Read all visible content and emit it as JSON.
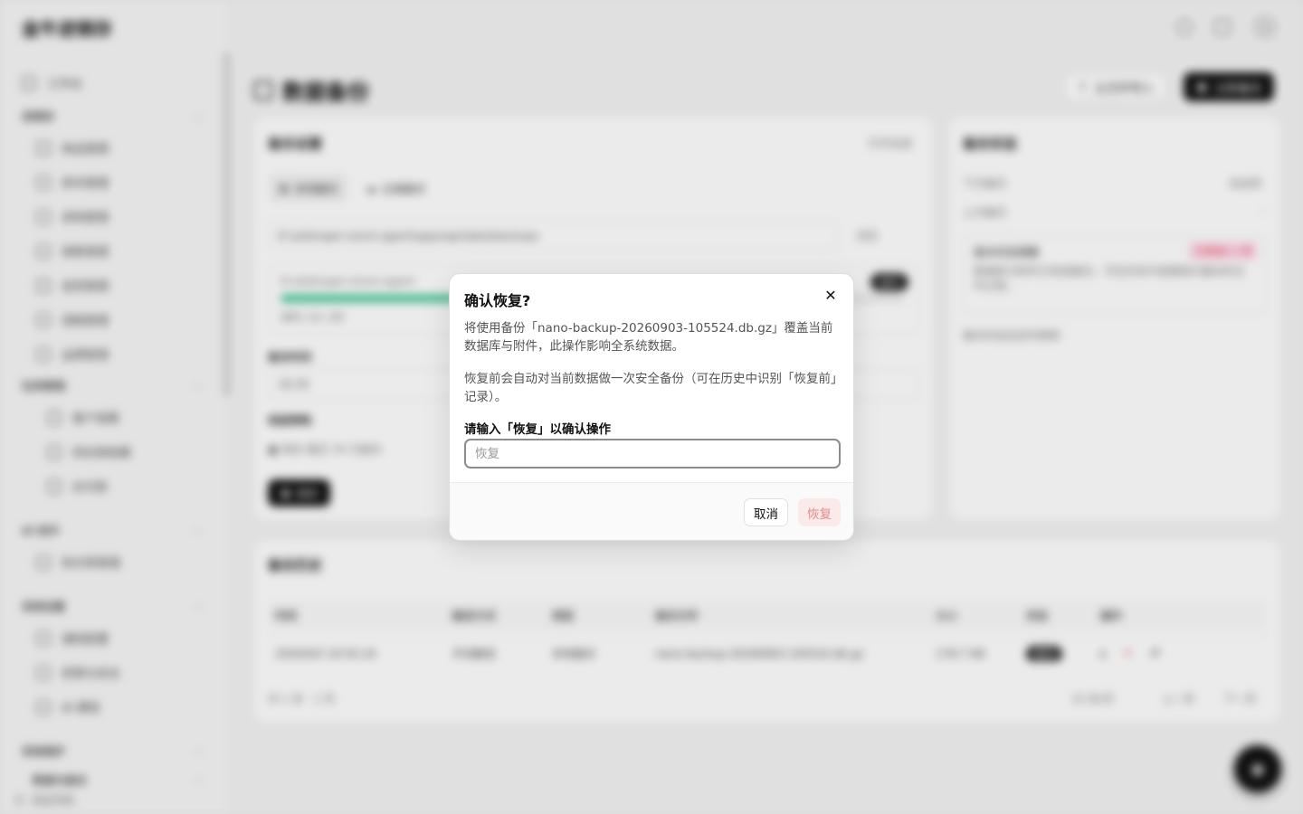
{
  "app": {
    "brand": "金牛进销存",
    "page_title": "数据备份",
    "import_label": "从文件导入",
    "backup_now_label": "立即备份"
  },
  "sidebar": {
    "workbench": "工作台",
    "groups": [
      {
        "label": "进销存",
        "items": [
          "商品管理",
          "库存管理",
          "采购管理",
          "销售管理",
          "退货管理",
          "调拨管理",
          "品牌管理"
        ]
      },
      {
        "label": "往来管理",
        "items": [
          "客户档案",
          "供应商档案",
          "应付款"
        ]
      },
      {
        "label": "AI 助手",
        "items": [
          "知识库管理"
        ]
      },
      {
        "label": "系统设置",
        "items": [
          "通知配置",
          "权限与安全",
          "AI 模型"
        ]
      },
      {
        "label": "系统维护",
        "items": []
      },
      {
        "label": "数据与备份",
        "items": []
      }
    ],
    "footer": "收起导航"
  },
  "backup_settings": {
    "title": "备份设置",
    "open_dir": "打开目录",
    "tab_local": "本地备份",
    "tab_cloud": "云端备份",
    "path": "D:\\ai\\bingen-stock-agent\\apps\\api\\data\\backups",
    "browse": "浏览",
    "progress_path": "D:\\ai\\bingen-stock-agent",
    "progress_percent": 62,
    "progress_badge": "运行",
    "progress_meta": "用时 2分 1秒",
    "time_label": "备份时间",
    "time_value": "18:30",
    "retain_label": "保留策略",
    "retain_value": "保存 最近 30 次备份",
    "save": "保存"
  },
  "backup_status": {
    "title": "备份状态",
    "next_label": "下次备份",
    "next_value": "未启用",
    "last_label": "上次备份",
    "last_value": "-",
    "note_title": "备份状态提醒",
    "note_badge": "已释放 1 项",
    "note_text": "数据库与附件已完成备份，可在历史中查看每次备份的文件记录。",
    "hint": "备份状态会定时刷新"
  },
  "history": {
    "title": "备份历史",
    "columns": [
      "时间",
      "触发方式",
      "类型",
      "备份文件",
      "大小",
      "状态",
      "操作"
    ],
    "rows": [
      {
        "time": "2026/9/3 10:55:24",
        "trigger": "手动触发",
        "type": "本地备份",
        "file": "nano-backup-20260903-105524.db.gz",
        "size": "178.7 KB",
        "status": "成功"
      }
    ],
    "pagination": {
      "total": "共 1 条",
      "page": "1 页",
      "page_size": "10 条/页",
      "prev": "上一页",
      "next": "下一页"
    }
  },
  "modal": {
    "title": "确认恢复?",
    "body1": "将使用备份「nano-backup-20260903-105524.db.gz」覆盖当前数据库与附件，此操作影响全系统数据。",
    "body2": "恢复前会自动对当前数据做一次安全备份（可在历史中识别「恢复前」记录）。",
    "confirm_label": "请输入「恢复」以确认操作",
    "input_placeholder": "恢复",
    "input_value": "",
    "cancel": "取消",
    "restore": "恢复",
    "colors": {
      "restore_bg": "#fbeaea",
      "restore_text": "#e38b8b",
      "progress": "#34c38f"
    }
  }
}
